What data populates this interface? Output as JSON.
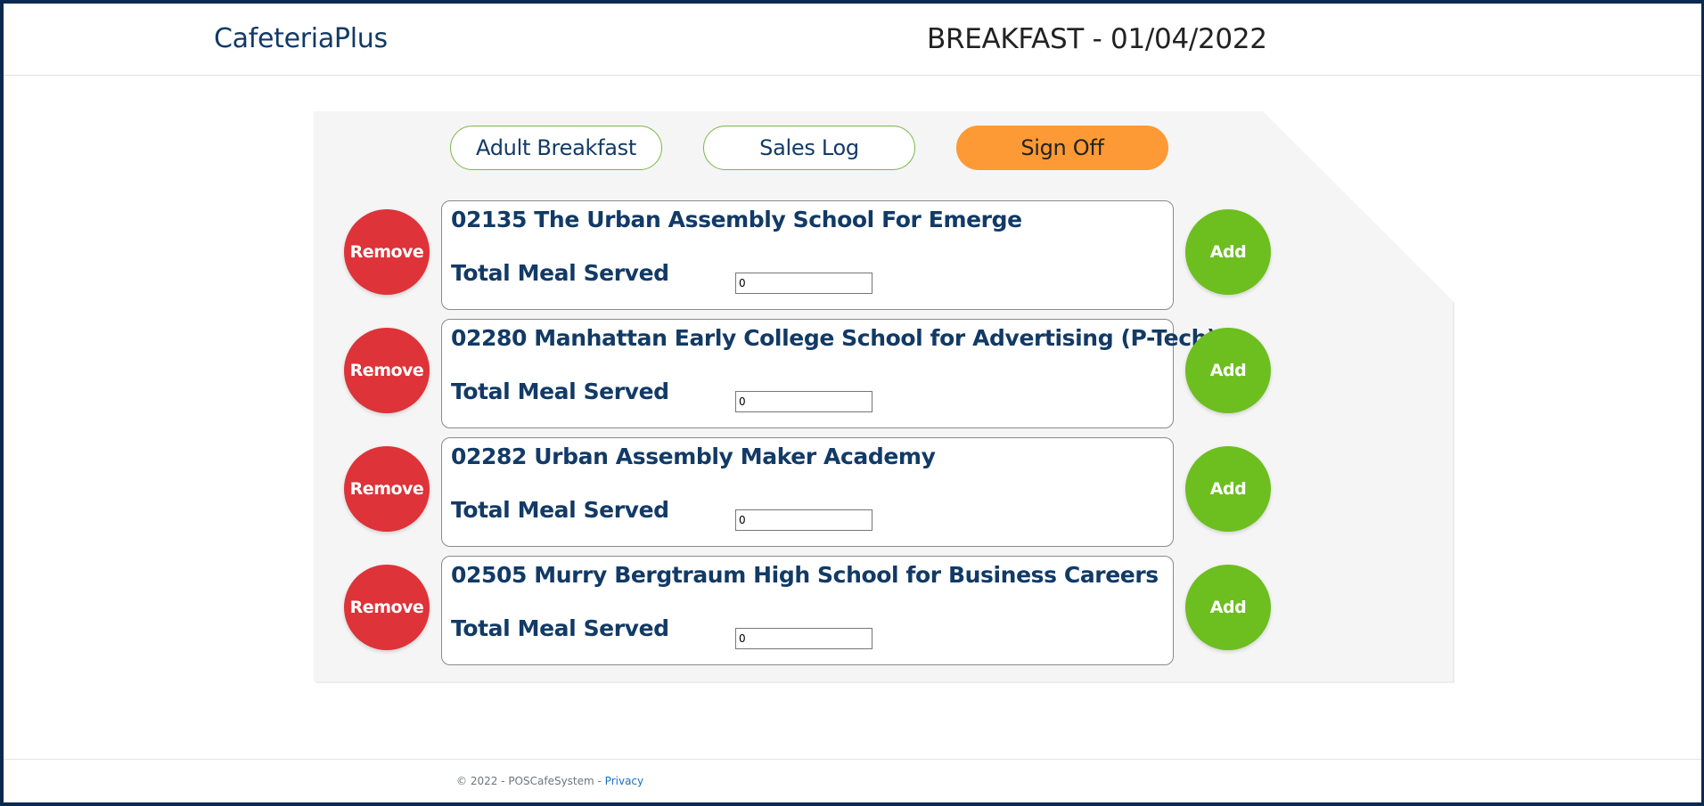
{
  "header": {
    "brand": "CafeteriaPlus",
    "title": "BREAKFAST - 01/04/2022"
  },
  "nav": {
    "adult_breakfast": "Adult Breakfast",
    "sales_log": "Sales Log",
    "sign_off": "Sign Off"
  },
  "schools": [
    {
      "name": "02135 The Urban Assembly School For Emerge",
      "meal_label": "Total Meal Served",
      "value": "0",
      "remove_label": "Remove",
      "add_label": "Add"
    },
    {
      "name": "02280 Manhattan Early College School for Advertising (P-Tech)",
      "meal_label": "Total Meal Served",
      "value": "0",
      "remove_label": "Remove",
      "add_label": "Add"
    },
    {
      "name": "02282 Urban Assembly Maker Academy",
      "meal_label": "Total Meal Served",
      "value": "0",
      "remove_label": "Remove",
      "add_label": "Add"
    },
    {
      "name": "02505 Murry Bergtraum High School for Business Careers",
      "meal_label": "Total Meal Served",
      "value": "0",
      "remove_label": "Remove",
      "add_label": "Add"
    }
  ],
  "footer": {
    "copyright": "© 2022 - POSCafeSystem - ",
    "privacy": "Privacy"
  },
  "colors": {
    "brand_navy": "#123a66",
    "remove_red": "#dd3339",
    "add_green": "#6cbf1e",
    "signoff_orange": "#fd9a35",
    "nav_border_green": "#7ab648"
  }
}
